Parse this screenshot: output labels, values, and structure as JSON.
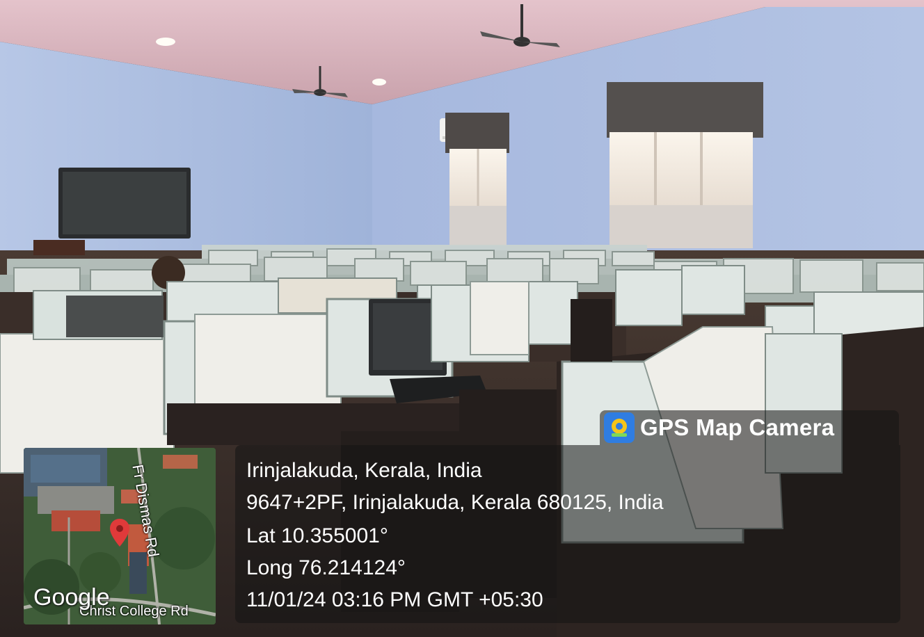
{
  "app": {
    "name": "GPS Map Camera",
    "brand_color": "#2f7de1",
    "icon": "map-pin-camera-icon"
  },
  "location": {
    "place": "Irinjalakuda, Kerala, India",
    "address": "9647+2PF, Irinjalakuda, Kerala 680125, India",
    "latitude": "Lat 10.355001°",
    "longitude": "Long 76.214124°",
    "datetime": "11/01/24 03:16 PM GMT +05:30"
  },
  "map": {
    "provider": "Google",
    "road_label_1": "Fr Dismas Rd",
    "road_label_2": "Christ College Rd",
    "marker_color": "#e03a3a",
    "marker_icon": "map-pin-icon"
  },
  "colors": {
    "wall": "#a9bde0",
    "ceiling": "#d9b7c0",
    "overlay_bg": "rgba(20,20,20,0.55)"
  }
}
